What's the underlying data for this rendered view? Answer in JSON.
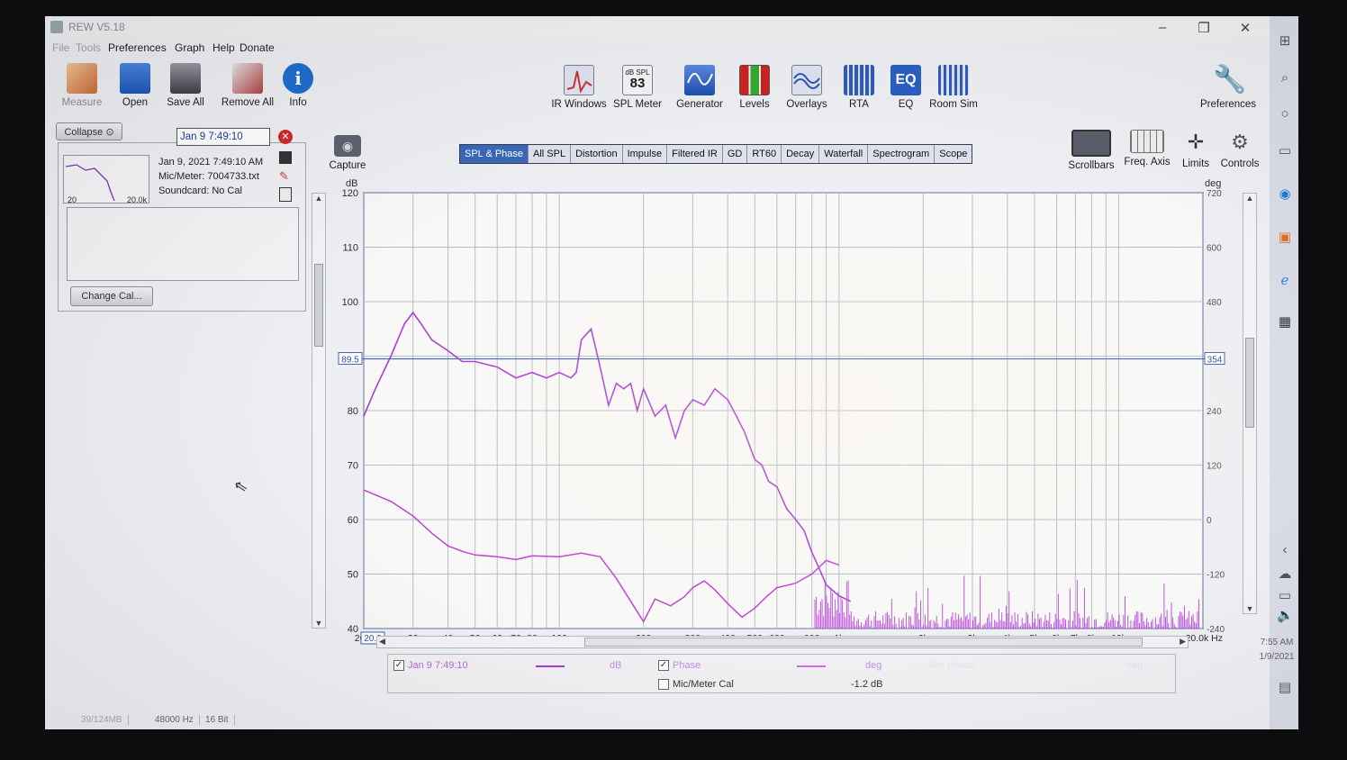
{
  "window": {
    "title": "REW V5.18",
    "controls": [
      "–",
      "❐",
      "✕"
    ]
  },
  "menu": {
    "items": [
      "File",
      "Tools",
      "Preferences",
      "Graph",
      "Help",
      "Donate"
    ]
  },
  "toolbar_left": [
    {
      "label": "Measure",
      "icon": "measure-icon",
      "color": "#d9864a"
    },
    {
      "label": "Open",
      "icon": "folder-icon",
      "color": "#2f6fd1"
    },
    {
      "label": "Save All",
      "icon": "save-all-icon",
      "color": "#5b5b66"
    },
    {
      "label": "Remove All",
      "icon": "remove-all-icon",
      "color": "#c03a3a"
    },
    {
      "label": "Info",
      "icon": "info-icon",
      "color": "#1f6dd0"
    }
  ],
  "toolbar_center": [
    {
      "label": "IR Windows",
      "icon": "ir-windows-icon"
    },
    {
      "label": "SPL Meter",
      "icon": "spl-meter-icon",
      "badge_top": "dB SPL",
      "badge_value": "83"
    },
    {
      "label": "Generator",
      "icon": "generator-icon"
    },
    {
      "label": "Levels",
      "icon": "levels-icon"
    },
    {
      "label": "Overlays",
      "icon": "overlays-icon"
    },
    {
      "label": "RTA",
      "icon": "rta-icon"
    },
    {
      "label": "EQ",
      "icon": "eq-icon"
    },
    {
      "label": "Room Sim",
      "icon": "room-sim-icon"
    }
  ],
  "preferences_label": "Preferences",
  "capture_label": "Capture",
  "view_controls": [
    {
      "label": "Scrollbars",
      "icon": "scrollbars-icon"
    },
    {
      "label": "Freq. Axis",
      "icon": "freq-axis-icon"
    },
    {
      "label": "Limits",
      "icon": "limits-icon"
    },
    {
      "label": "Controls",
      "icon": "controls-gear-icon"
    }
  ],
  "tabs": [
    "SPL & Phase",
    "All SPL",
    "Distortion",
    "Impulse",
    "Filtered IR",
    "GD",
    "RT60",
    "Decay",
    "Waterfall",
    "Spectrogram",
    "Scope"
  ],
  "active_tab": "SPL & Phase",
  "measurement": {
    "collapse_label": "Collapse",
    "name": "Jan 9 7:49:10",
    "date_line": "Jan 9, 2021 7:49:10 AM",
    "mic_line": "Mic/Meter: 7004733.txt",
    "soundcard_line": "Soundcard: No Cal",
    "thumb_left": "20",
    "thumb_right": "20.0k",
    "change_cal_label": "Change Cal..."
  },
  "legend": {
    "series1_name": "Jan 9 7:49:10",
    "series1_unit": "dB",
    "phase_name": "Phase",
    "phase_unit": "deg",
    "minphase_name": "Min phase",
    "minphase_unit": "deg",
    "cal_name": "Mic/Meter Cal",
    "cal_value": "-1.2 dB"
  },
  "status": {
    "memory": "39/124MB",
    "samplerate": "48000 Hz",
    "bits": "16 Bit"
  },
  "clock": {
    "time": "7:55 AM",
    "date": "1/9/2021"
  },
  "cursor_readouts": {
    "left": "89.5",
    "right": "354",
    "x_start": "20.0"
  },
  "colors": {
    "spl": "#a53bd2",
    "phase": "#c040d0",
    "grid": "#b9bcc8",
    "cursor": "#4a66b0"
  },
  "chart_data": {
    "type": "line",
    "title": "",
    "ylabel": "dB",
    "y2label": "deg",
    "xscale": "log",
    "xlim": [
      20,
      20000
    ],
    "ylim": [
      40,
      120
    ],
    "y2lim": [
      -240,
      720
    ],
    "x_ticks": [
      "20.0",
      "30",
      "40",
      "50",
      "60",
      "70",
      "80",
      "100",
      "200",
      "300",
      "400",
      "500",
      "600",
      "800",
      "1k",
      "2k",
      "3k",
      "4k",
      "5k",
      "6k",
      "7k",
      "8k",
      "10k",
      "20.0k Hz"
    ],
    "y_ticks": [
      120,
      110,
      100,
      80,
      70,
      60,
      50,
      40
    ],
    "y2_ticks": [
      720,
      600,
      480,
      240,
      120,
      0,
      -120,
      -240
    ],
    "series": [
      {
        "name": "Jan 9 7:49:10",
        "axis": "left",
        "x": [
          20,
          22,
          25,
          28,
          30,
          32,
          35,
          40,
          45,
          50,
          60,
          70,
          80,
          90,
          100,
          110,
          115,
          120,
          130,
          140,
          150,
          160,
          170,
          180,
          190,
          200,
          220,
          240,
          260,
          280,
          300,
          330,
          360,
          400,
          430,
          460,
          500,
          530,
          560,
          600,
          650,
          700,
          750,
          800,
          850,
          900,
          1000,
          1100
        ],
        "values": [
          79,
          84,
          90,
          96,
          98,
          96,
          93,
          91,
          89,
          89,
          88,
          86,
          87,
          86,
          87,
          86,
          87,
          93,
          95,
          88,
          81,
          85,
          84,
          85,
          80,
          84,
          79,
          81,
          75,
          80,
          82,
          81,
          84,
          82,
          79,
          76,
          71,
          70,
          67,
          66,
          62,
          60,
          58,
          54,
          51,
          48,
          46,
          45
        ]
      },
      {
        "name": "Phase",
        "axis": "right",
        "x": [
          20,
          25,
          30,
          35,
          40,
          45,
          50,
          60,
          70,
          80,
          100,
          120,
          140,
          160,
          180,
          200,
          220,
          250,
          280,
          300,
          330,
          360,
          400,
          450,
          500,
          550,
          600,
          650,
          700,
          800,
          900,
          1000
        ],
        "values": [
          65,
          40,
          8,
          -30,
          -58,
          -70,
          -78,
          -82,
          -88,
          -80,
          -82,
          -74,
          -82,
          -130,
          -180,
          -225,
          -175,
          -190,
          -170,
          -150,
          -135,
          -155,
          -185,
          -215,
          -195,
          -170,
          -150,
          -145,
          -140,
          -120,
          -90,
          -100
        ]
      }
    ]
  }
}
